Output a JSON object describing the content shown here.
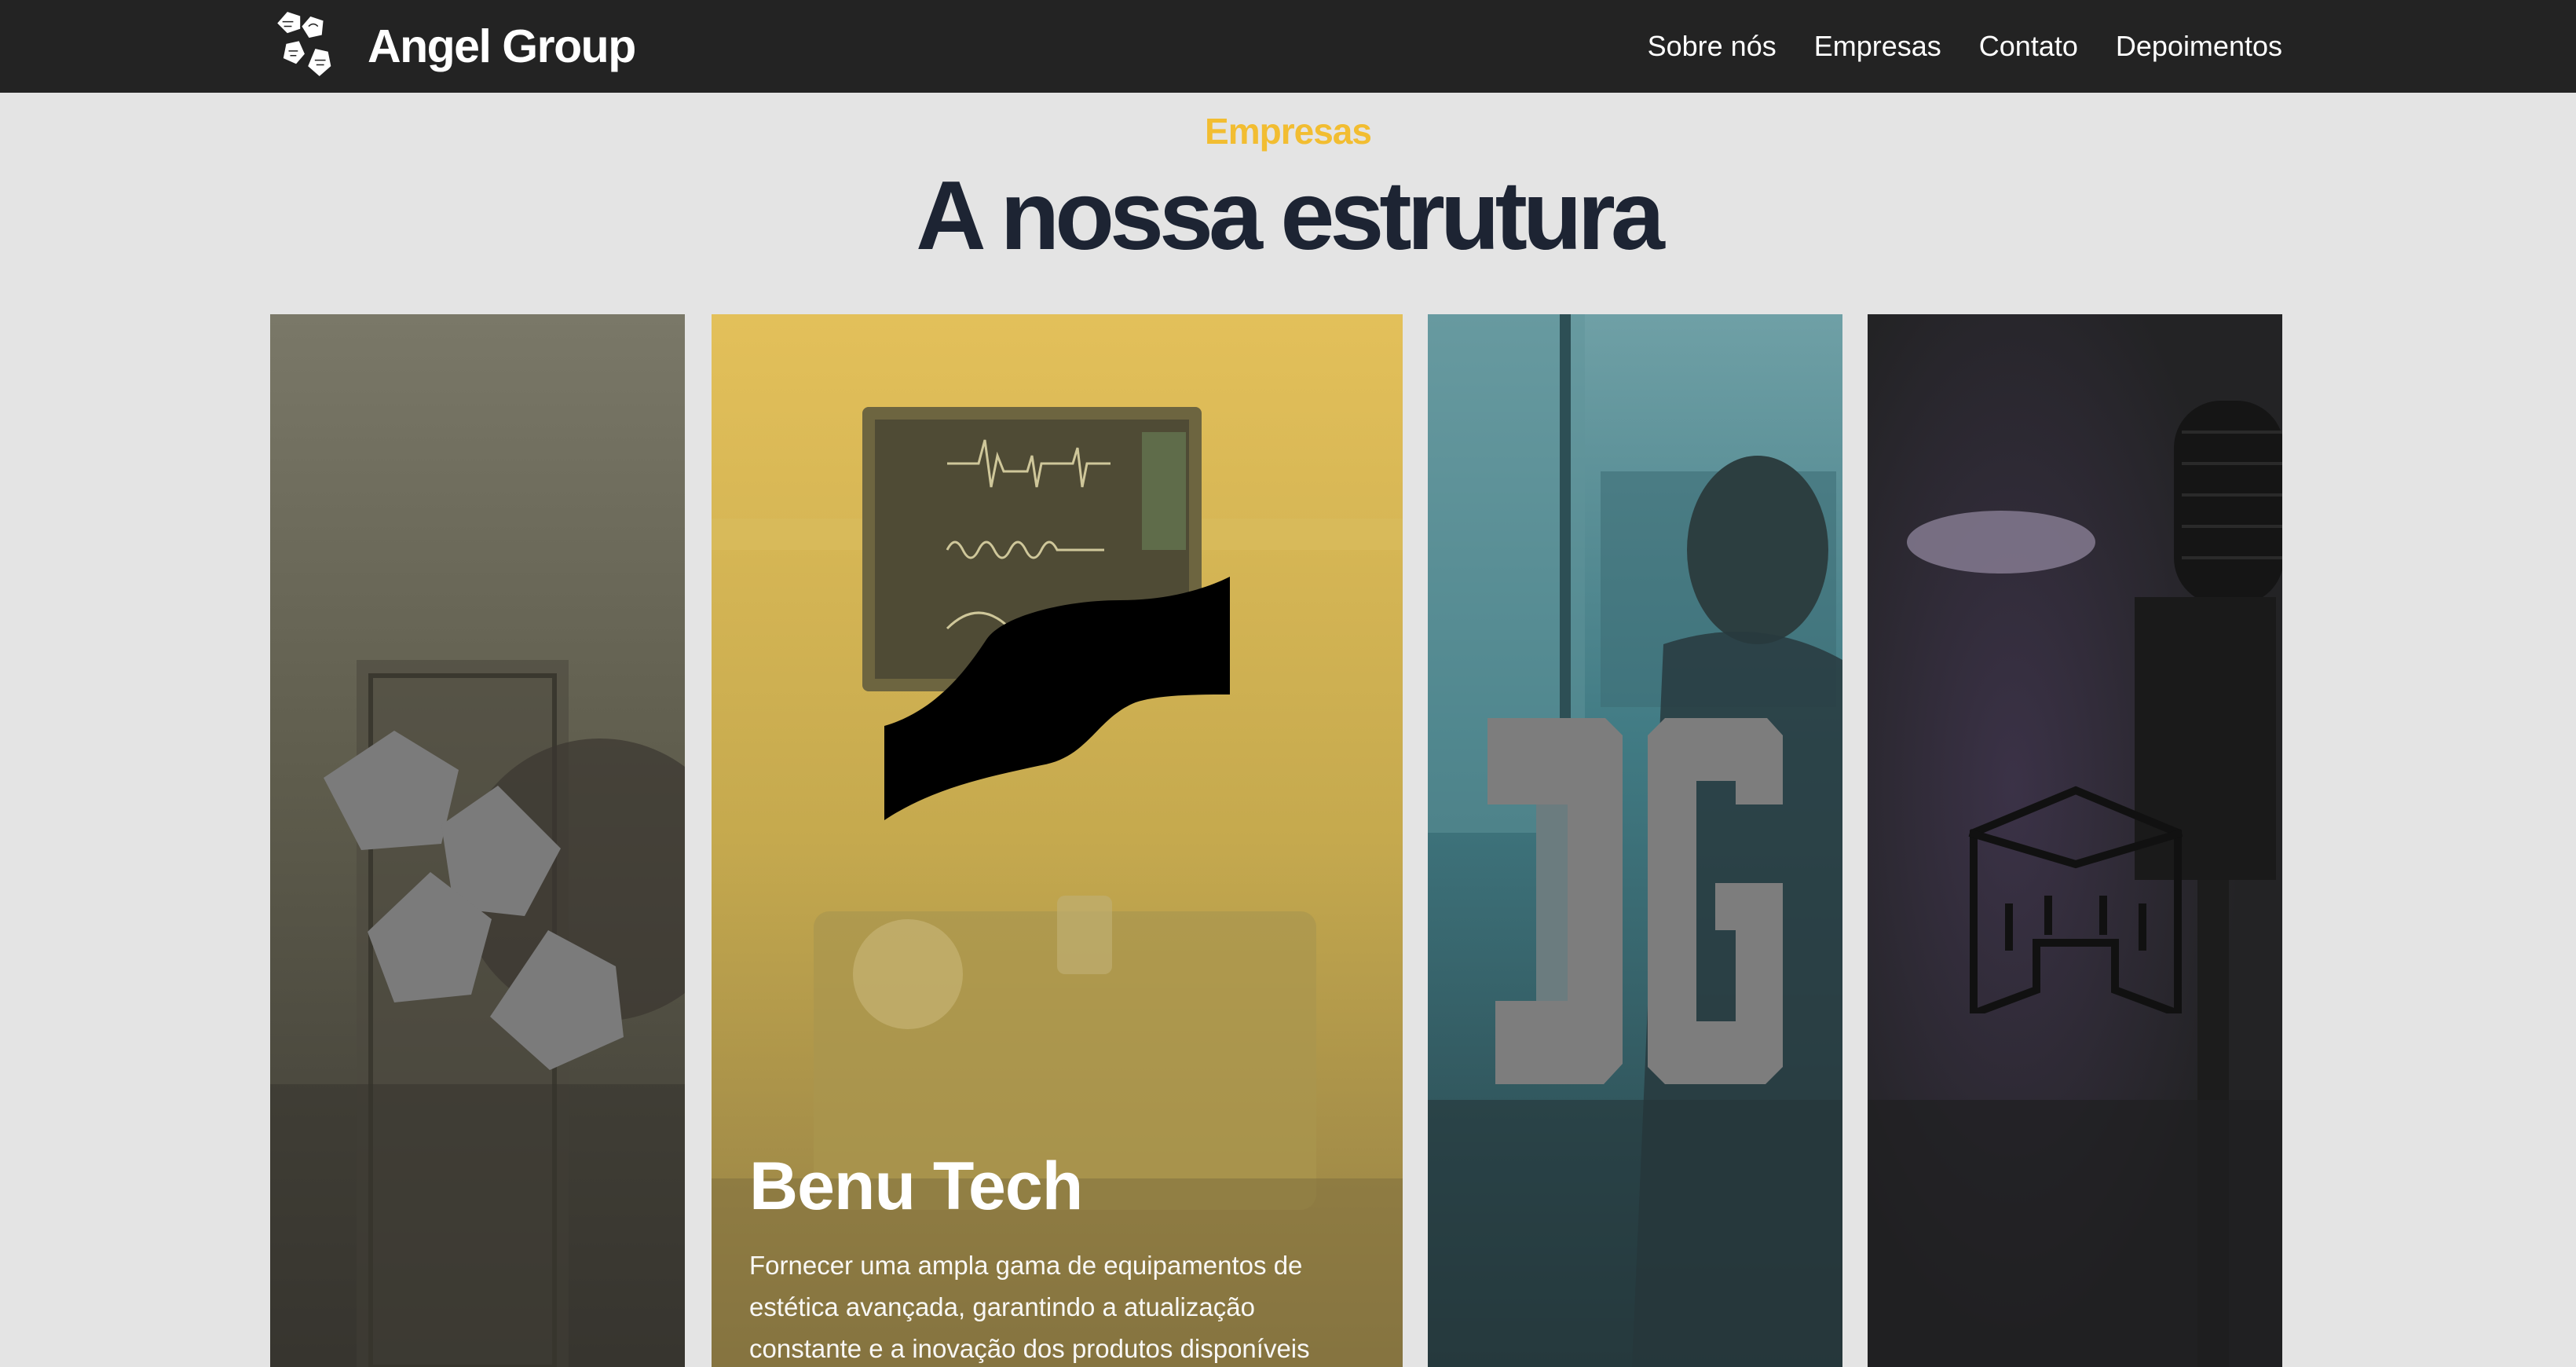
{
  "header": {
    "brand_name": "Angel Group",
    "nav": [
      {
        "label": "Sobre nós"
      },
      {
        "label": "Empresas"
      },
      {
        "label": "Contato"
      },
      {
        "label": "Depoimentos"
      }
    ]
  },
  "section": {
    "eyebrow": "Empresas",
    "title": "A nossa estrutura"
  },
  "cards": [
    {
      "logo": "pentagon-cluster-icon",
      "tint": "#6e6a55"
    },
    {
      "logo": "benu-tech-wave-icon",
      "tint": "#e2bd4e",
      "title": "Benu Tech",
      "description": "Fornecer uma ampla gama de equipamentos de estética avançada, garantindo a atualização constante e a inovação dos produtos disponíveis"
    },
    {
      "logo": "dg-monogram-icon",
      "tint": "#3e7780"
    },
    {
      "logo": "castle-outline-icon",
      "tint": "#2a2a2e"
    }
  ],
  "colors": {
    "navbar": "#232323",
    "background": "#e4e4e4",
    "accent": "#f2bd31",
    "title": "#1d2433"
  }
}
